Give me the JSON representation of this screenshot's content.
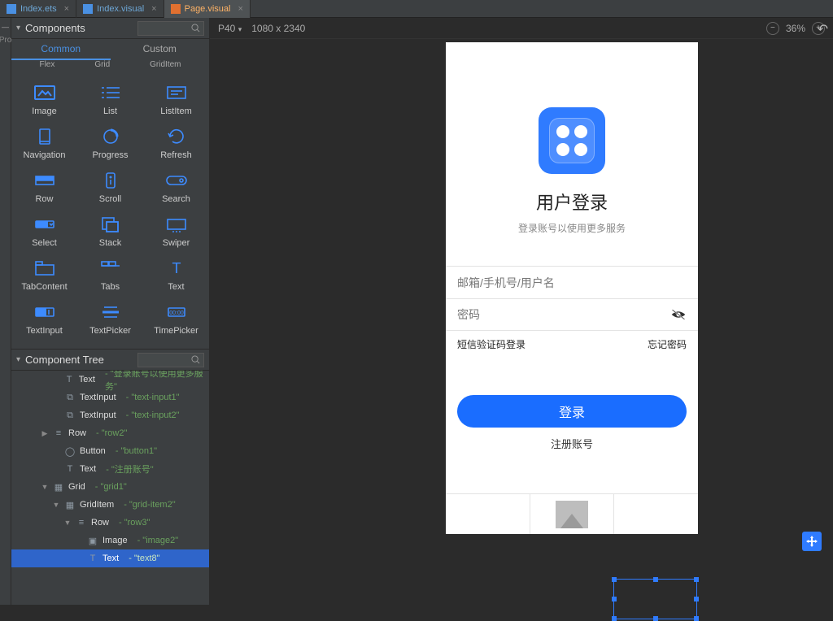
{
  "tabs": [
    {
      "name": "Index.ets",
      "active": false,
      "color": "#6ea8d8"
    },
    {
      "name": "Index.visual",
      "active": false,
      "color": "#6ea8d8"
    },
    {
      "name": "Page.visual",
      "active": true,
      "color": "#ffb366"
    }
  ],
  "leftStrip": {
    "label": "Pro"
  },
  "componentsPanel": {
    "title": "Components",
    "subtabs": [
      "Common",
      "Custom"
    ],
    "hintRow": [
      "Flex",
      "Grid",
      "GridItem"
    ],
    "items": [
      {
        "label": "Image"
      },
      {
        "label": "List"
      },
      {
        "label": "ListItem"
      },
      {
        "label": "Navigation"
      },
      {
        "label": "Progress"
      },
      {
        "label": "Refresh"
      },
      {
        "label": "Row"
      },
      {
        "label": "Scroll"
      },
      {
        "label": "Search"
      },
      {
        "label": "Select"
      },
      {
        "label": "Stack"
      },
      {
        "label": "Swiper"
      },
      {
        "label": "TabContent"
      },
      {
        "label": "Tabs"
      },
      {
        "label": "Text"
      },
      {
        "label": "TextInput"
      },
      {
        "label": "TextPicker"
      },
      {
        "label": "TimePicker"
      }
    ]
  },
  "treePanel": {
    "title": "Component Tree",
    "rows": [
      {
        "indent": 3,
        "icon": "T",
        "type": "Text",
        "val": "- \"登录账号以使用更多服务\""
      },
      {
        "indent": 3,
        "icon": "⧉",
        "type": "TextInput",
        "val": "- \"text-input1\""
      },
      {
        "indent": 3,
        "icon": "⧉",
        "type": "TextInput",
        "val": "- \"text-input2\""
      },
      {
        "indent": 2,
        "chev": "▶",
        "icon": "≡",
        "type": "Row",
        "val": "- \"row2\""
      },
      {
        "indent": 3,
        "icon": "◯",
        "type": "Button",
        "val": "- \"button1\""
      },
      {
        "indent": 3,
        "icon": "T",
        "type": "Text",
        "val": "- \"注册账号\""
      },
      {
        "indent": 2,
        "chev": "▼",
        "icon": "▦",
        "type": "Grid",
        "val": "- \"grid1\""
      },
      {
        "indent": 3,
        "chev": "▼",
        "icon": "▦",
        "type": "GridItem",
        "val": "- \"grid-item2\""
      },
      {
        "indent": 4,
        "chev": "▼",
        "icon": "≡",
        "type": "Row",
        "val": "- \"row3\""
      },
      {
        "indent": 5,
        "icon": "▣",
        "type": "Image",
        "val": "- \"image2\""
      },
      {
        "indent": 5,
        "icon": "T",
        "type": "Text",
        "val": "- \"text8\"",
        "selected": true
      }
    ]
  },
  "canvasBar": {
    "device": "P40",
    "resolution": "1080 x 2340",
    "zoom": "36%"
  },
  "preview": {
    "title": "用户登录",
    "subtitle": "登录账号以使用更多服务",
    "field1": "邮箱/手机号/用户名",
    "field2": "密码",
    "smsLogin": "短信验证码登录",
    "forgot": "忘记密码",
    "loginBtn": "登录",
    "signup": "注册账号"
  }
}
